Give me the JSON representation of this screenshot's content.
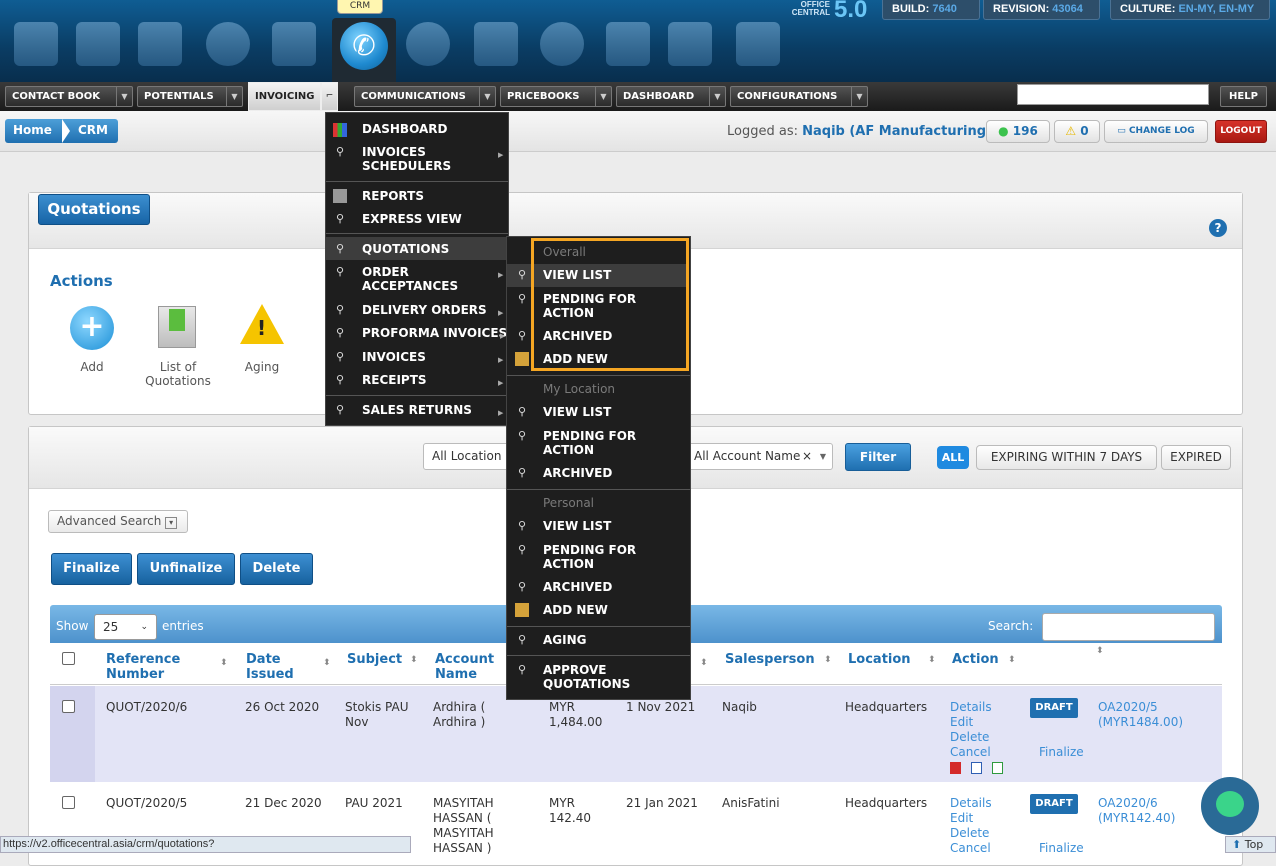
{
  "header": {
    "crm_tooltip": "CRM",
    "brand_top": "OFFICE",
    "brand_mid": "CENTRAL",
    "brand_version": "5.0",
    "build_label": "BUILD:",
    "build_value": "7640",
    "revision_label": "REVISION:",
    "revision_value": "43064",
    "culture_label": "CULTURE:",
    "culture_value": "EN-MY, EN-MY",
    "app_icons": [
      "desktop-icon",
      "contacts-icon",
      "mail-icon",
      "pie-chart-icon",
      "notes-icon",
      "phone-icon",
      "chat-icon",
      "documents-icon",
      "info-icon",
      "checklist-icon",
      "monitor-icon",
      "lock-icon"
    ]
  },
  "nav": {
    "items": [
      "CONTACT BOOK",
      "POTENTIALS",
      "INVOICING",
      "COMMUNICATIONS",
      "PRICEBOOKS",
      "DASHBOARD",
      "CONFIGURATIONS"
    ],
    "help": "HELP"
  },
  "breadcrumb": {
    "home": "Home",
    "crm": "CRM"
  },
  "session": {
    "logged_as_label": "Logged as:",
    "logged_as_user": "Naqib (AF Manufacturing)",
    "online_count": "196",
    "warning_count": "0",
    "change_log": "CHANGE LOG",
    "logout": "LOGOUT"
  },
  "page": {
    "title": "Quotations",
    "actions_title": "Actions",
    "actions": [
      {
        "label": "Add",
        "icon": "add-icon"
      },
      {
        "label": "List of Quotations",
        "icon": "list-icon"
      },
      {
        "label": "Aging",
        "icon": "warning-icon"
      }
    ]
  },
  "filters": {
    "location": "All Location",
    "account": "All Account Name",
    "filter_btn": "Filter",
    "tags": [
      "ALL",
      "EXPIRING WITHIN 7 DAYS",
      "EXPIRED"
    ]
  },
  "toolbar": {
    "advanced_search": "Advanced Search",
    "finalize": "Finalize",
    "unfinalize": "Unfinalize",
    "delete": "Delete"
  },
  "table": {
    "show_label": "Show",
    "page_size": "25",
    "entries_label": "entries",
    "search_label": "Search:",
    "columns": [
      "Reference Number",
      "Date Issued",
      "Subject",
      "Account Name",
      "",
      "",
      "Salesperson",
      "Location",
      "Action"
    ],
    "rows": [
      {
        "ref": "QUOT/2020/6",
        "date": "26 Oct 2020",
        "subject": "Stokis PAU Nov",
        "account": "Ardhira ( Ardhira )",
        "amount": "MYR 1,484.00",
        "expiry": "1 Nov 2021",
        "salesperson": "Naqib",
        "location": "Headquarters",
        "actions": [
          "Details",
          "Edit",
          "Delete",
          "Cancel"
        ],
        "status": "DRAFT",
        "finalize": "Finalize",
        "order": "OA2020/5 (MYR1484.00)"
      },
      {
        "ref": "QUOT/2020/5",
        "date": "21 Dec 2020",
        "subject": "PAU 2021",
        "account": "MASYITAH HASSAN ( MASYITAH HASSAN )",
        "amount": "MYR 142.40",
        "expiry": "21 Jan 2021",
        "salesperson": "AnisFatini",
        "location": "Headquarters",
        "actions": [
          "Details",
          "Edit",
          "Delete",
          "Cancel"
        ],
        "status": "DRAFT",
        "finalize": "Finalize",
        "order": "OA2020/6 (MYR142.40)"
      }
    ]
  },
  "invoicing_menu": {
    "items": [
      {
        "label": "DASHBOARD",
        "icon": "chart-icon",
        "sub": false
      },
      {
        "label": "INVOICES SCHEDULERS",
        "icon": "search-icon",
        "sub": true
      },
      {
        "label": "REPORTS",
        "icon": "report-icon",
        "sub": false
      },
      {
        "label": "EXPRESS VIEW",
        "icon": "search-icon",
        "sub": false
      },
      {
        "label": "QUOTATIONS",
        "icon": "search-icon",
        "sub": true
      },
      {
        "label": "ORDER ACCEPTANCES",
        "icon": "search-icon",
        "sub": true
      },
      {
        "label": "DELIVERY ORDERS",
        "icon": "search-icon",
        "sub": true
      },
      {
        "label": "PROFORMA INVOICES",
        "icon": "search-icon",
        "sub": true
      },
      {
        "label": "INVOICES",
        "icon": "search-icon",
        "sub": true
      },
      {
        "label": "RECEIPTS",
        "icon": "search-icon",
        "sub": true
      },
      {
        "label": "SALES RETURNS",
        "icon": "search-icon",
        "sub": true
      }
    ]
  },
  "quotations_submenu": {
    "overall_header": "Overall",
    "my_location_header": "My Location",
    "personal_header": "Personal",
    "view_list": "VIEW LIST",
    "pending": "PENDING FOR ACTION",
    "archived": "ARCHIVED",
    "add_new": "ADD NEW",
    "aging": "AGING",
    "approve": "APPROVE QUOTATIONS"
  },
  "status_bar": {
    "url": "https://v2.officecentral.asia/crm/quotations?",
    "top": "Top"
  },
  "colors": {
    "accent": "#1f6fb0",
    "highlight": "#f5a623",
    "menu_bg": "#1e1e1e"
  }
}
